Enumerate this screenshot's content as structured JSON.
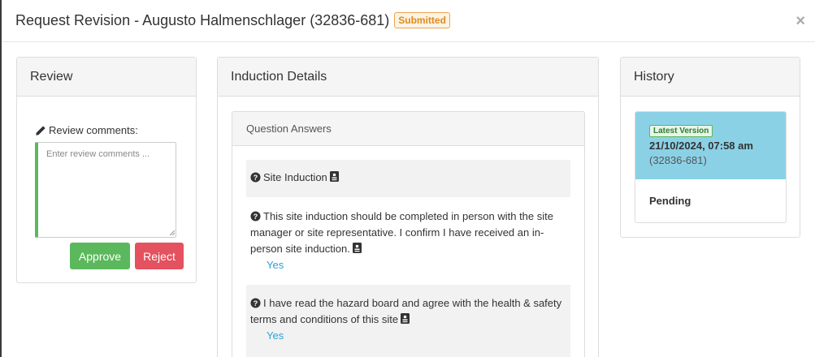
{
  "modal": {
    "title": "Request Revision - Augusto Halmenschlager (32836-681)",
    "status_badge": "Submitted",
    "close_label": "×"
  },
  "review": {
    "heading": "Review",
    "comments_label": "Review comments:",
    "comments_placeholder": "Enter review comments ...",
    "comments_value": "",
    "approve_label": "Approve",
    "reject_label": "Reject"
  },
  "induction": {
    "heading": "Induction Details",
    "sub_heading": "Question Answers",
    "questions": [
      {
        "text": "Site Induction",
        "answer": ""
      },
      {
        "text": "This site induction should be completed in person with the site manager or site representative. I confirm I have received an in-person site induction.",
        "answer": "Yes"
      },
      {
        "text": "I have read the hazard board and agree with the health & safety terms and conditions of this site",
        "answer": "Yes"
      }
    ]
  },
  "history": {
    "heading": "History",
    "items": [
      {
        "badge": "Latest Version",
        "date": "21/10/2024, 07:58 am",
        "ref": "(32836-681)",
        "status": "Pending"
      }
    ]
  },
  "colors": {
    "approve": "#5cb85c",
    "reject": "#e4515f",
    "history_highlight": "#8bd1e6",
    "answer_link": "#29a4d4",
    "submitted_badge": "#e08a1e"
  },
  "icons": [
    "pencil-icon",
    "question-circle-icon",
    "id-card-icon",
    "close-icon"
  ]
}
